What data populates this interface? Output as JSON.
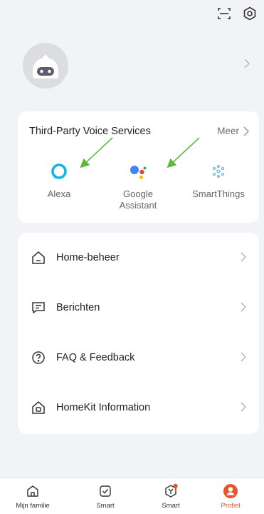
{
  "header": {
    "scan_icon": "scan-icon",
    "settings_icon": "settings-icon"
  },
  "profile": {
    "avatar_icon": "robot-avatar"
  },
  "voice_services": {
    "title": "Third-Party Voice Services",
    "more_label": "Meer",
    "items": [
      {
        "label": "Alexa",
        "icon": "alexa-icon"
      },
      {
        "label": "Google\nAssistant",
        "icon": "google-assistant-icon"
      },
      {
        "label": "SmartThings",
        "icon": "smartthings-icon"
      }
    ]
  },
  "menu": {
    "items": [
      {
        "label": "Home-beheer",
        "icon": "home-icon"
      },
      {
        "label": "Berichten",
        "icon": "message-icon"
      },
      {
        "label": "FAQ & Feedback",
        "icon": "question-icon"
      },
      {
        "label": "HomeKit Information",
        "icon": "homekit-icon"
      }
    ]
  },
  "tabbar": {
    "items": [
      {
        "label": "Mijn familie",
        "icon": "home-tab-icon"
      },
      {
        "label": "Smart",
        "icon": "smart-check-icon"
      },
      {
        "label": "Smart",
        "icon": "smart-scenes-icon"
      },
      {
        "label": "Profiel",
        "icon": "profile-icon"
      }
    ],
    "active_color": "#e8542b"
  },
  "colors": {
    "background": "#f2f3f7",
    "card": "#ffffff",
    "annotation_arrow": "#5cb83c"
  }
}
